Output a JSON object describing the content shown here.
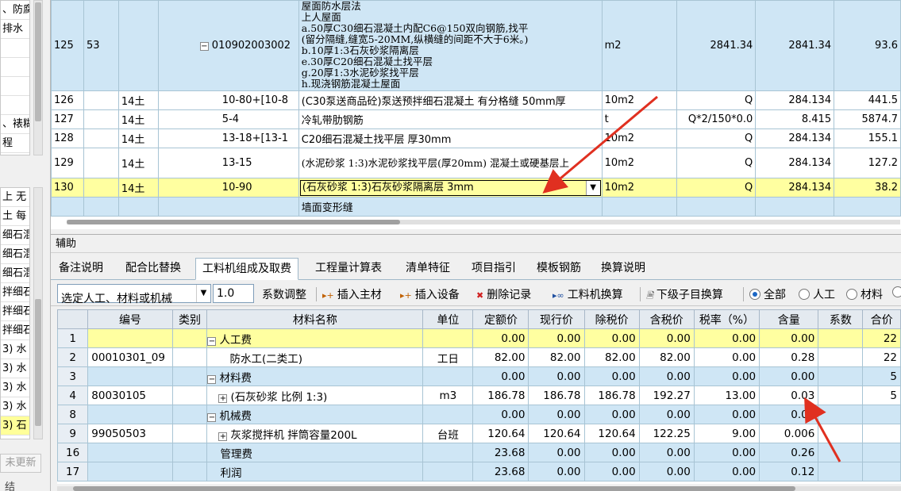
{
  "left_panel": {
    "top_items": [
      "、防腐",
      "排水",
      "",
      "",
      "",
      "",
      "、裱糊",
      "程"
    ],
    "bottom_items": [
      "上 无",
      "土 每",
      "细石混",
      "细石混",
      "细石混",
      "拌细石",
      "拌细石",
      "拌细石",
      "3) 水",
      "3) 水",
      "3) 水",
      "3) 水",
      "3) 石"
    ],
    "update_button": "未更新",
    "last_text": "结"
  },
  "top_table": {
    "rows": [
      {
        "row": "125",
        "seq": "53",
        "cat": "",
        "code": "010902003002",
        "desc_lines": [
          "屋面防水层法",
          "上人屋面",
          "a.50厚C30细石混凝土内配C6@150双向钢筋,找平",
          "(留分隔缝,缝宽5-20MM,纵横缝的间距不大于6米。)",
          "b.10厚1:3石灰砂浆隔离层",
          "e.30厚C20细石混凝土找平层",
          "g.20厚1:3水泥砂浆找平层",
          "h.现浇钢筋混凝土屋面"
        ],
        "unit": "m2",
        "qty_expr": "2841.34",
        "qty": "2841.34",
        "price": "93.6"
      },
      {
        "row": "126",
        "seq": "",
        "cat": "14土",
        "code": "10-80+[10-8",
        "desc": "(C30泵送商品砼)泵送预拌细石混凝土 有分格缝 50mm厚",
        "unit": "10m2",
        "qty_expr": "Q",
        "qty": "284.134",
        "price": "441.5"
      },
      {
        "row": "127",
        "seq": "",
        "cat": "14土",
        "code": "5-4",
        "desc": "冷轧带肋钢筋",
        "unit": "t",
        "qty_expr": "Q*2/150*0.0",
        "qty": "8.415",
        "price": "5874.7"
      },
      {
        "row": "128",
        "seq": "",
        "cat": "14土",
        "code": "13-18+[13-1",
        "desc": "C20细石混凝土找平层 厚30mm",
        "unit": "10m2",
        "qty_expr": "Q",
        "qty": "284.134",
        "price": "155.1"
      },
      {
        "row": "129",
        "seq": "",
        "cat": "14土",
        "code": "13-15",
        "desc": "(水泥砂浆 1:3)水泥砂浆找平层(厚20mm) 混凝土或硬基层上",
        "unit": "10m2",
        "qty_expr": "Q",
        "qty": "284.134",
        "price": "127.2"
      },
      {
        "row": "130",
        "seq": "",
        "cat": "14土",
        "code": "10-90",
        "desc": "(石灰砂浆 1:3)石灰砂浆隔离层 3mm",
        "unit": "10m2",
        "qty_expr": "Q",
        "qty": "284.134",
        "price": "38.2"
      },
      {
        "row": "",
        "seq": "",
        "cat": "",
        "code": "",
        "desc": "墙面变形缝",
        "unit": "",
        "qty_expr": "",
        "qty": "",
        "price": ""
      }
    ]
  },
  "panel_title": "辅助",
  "tabs": [
    "备注说明",
    "配合比替换",
    "工料机组成及取费",
    "工程量计算表",
    "清单特征",
    "项目指引",
    "模板钢筋",
    "换算说明"
  ],
  "active_tab": "工料机组成及取费",
  "toolbar": {
    "select_combo": "选定人工、材料或机械",
    "coef_value": "1.0",
    "coef_adjust": "系数调整",
    "insert_main": "插入主材",
    "insert_equip": "插入设备",
    "delete_record": "删除记录",
    "labor_convert": "工料机换算",
    "sub_convert": "下级子目换算",
    "filter_all": "全部",
    "filter_labor": "人工",
    "filter_material": "材料"
  },
  "bottom_table": {
    "headers": [
      "",
      "编号",
      "类别",
      "材料名称",
      "单位",
      "定额价",
      "现行价",
      "除税价",
      "含税价",
      "税率（%）",
      "含量",
      "系数",
      "合价"
    ],
    "rows": [
      {
        "rn": "1",
        "code": "",
        "cat": "",
        "name": "人工费",
        "expand": "minus",
        "indent": 0,
        "unit": "",
        "quota": "0.00",
        "current": "0.00",
        "notax": "0.00",
        "withtax": "0.00",
        "rate": "0.00",
        "content": "0.00",
        "coef": "",
        "total": "22",
        "style": "y"
      },
      {
        "rn": "2",
        "code": "00010301_09",
        "cat": "",
        "name": "防水工(二类工)",
        "expand": "",
        "indent": 1,
        "unit": "工日",
        "quota": "82.00",
        "current": "82.00",
        "notax": "82.00",
        "withtax": "82.00",
        "rate": "0.00",
        "content": "0.28",
        "coef": "",
        "total": "22",
        "style": ""
      },
      {
        "rn": "3",
        "code": "",
        "cat": "",
        "name": "材料费",
        "expand": "minus",
        "indent": 0,
        "unit": "",
        "quota": "0.00",
        "current": "0.00",
        "notax": "0.00",
        "withtax": "0.00",
        "rate": "0.00",
        "content": "0.00",
        "coef": "",
        "total": "5",
        "style": "b"
      },
      {
        "rn": "4",
        "code": "80030105",
        "cat": "",
        "name": "(石灰砂浆 比例 1:3)",
        "expand": "plus",
        "indent": 1,
        "unit": "m3",
        "quota": "186.78",
        "current": "186.78",
        "notax": "186.78",
        "withtax": "192.27",
        "rate": "13.00",
        "content": "0.03",
        "coef": "",
        "total": "5",
        "style": ""
      },
      {
        "rn": "8",
        "code": "",
        "cat": "",
        "name": "机械费",
        "expand": "minus",
        "indent": 0,
        "unit": "",
        "quota": "0.00",
        "current": "0.00",
        "notax": "0.00",
        "withtax": "0.00",
        "rate": "0.00",
        "content": "0.00",
        "coef": "",
        "total": "",
        "style": "b"
      },
      {
        "rn": "9",
        "code": "99050503",
        "cat": "",
        "name": "灰浆搅拌机 拌筒容量200L",
        "expand": "plus",
        "indent": 1,
        "unit": "台班",
        "quota": "120.64",
        "current": "120.64",
        "notax": "120.64",
        "withtax": "122.25",
        "rate": "9.00",
        "content": "0.006",
        "coef": "",
        "total": "",
        "style": ""
      },
      {
        "rn": "16",
        "code": "",
        "cat": "",
        "name": "管理费",
        "expand": "",
        "indent": 0,
        "unit": "",
        "quota": "23.68",
        "current": "0.00",
        "notax": "0.00",
        "withtax": "0.00",
        "rate": "0.00",
        "content": "0.26",
        "coef": "",
        "total": "",
        "style": "b"
      },
      {
        "rn": "17",
        "code": "",
        "cat": "",
        "name": "利润",
        "expand": "",
        "indent": 0,
        "unit": "",
        "quota": "23.68",
        "current": "0.00",
        "notax": "0.00",
        "withtax": "0.00",
        "rate": "0.00",
        "content": "0.12",
        "coef": "",
        "total": "",
        "style": "b"
      }
    ]
  },
  "annotation_color": "#e03020"
}
